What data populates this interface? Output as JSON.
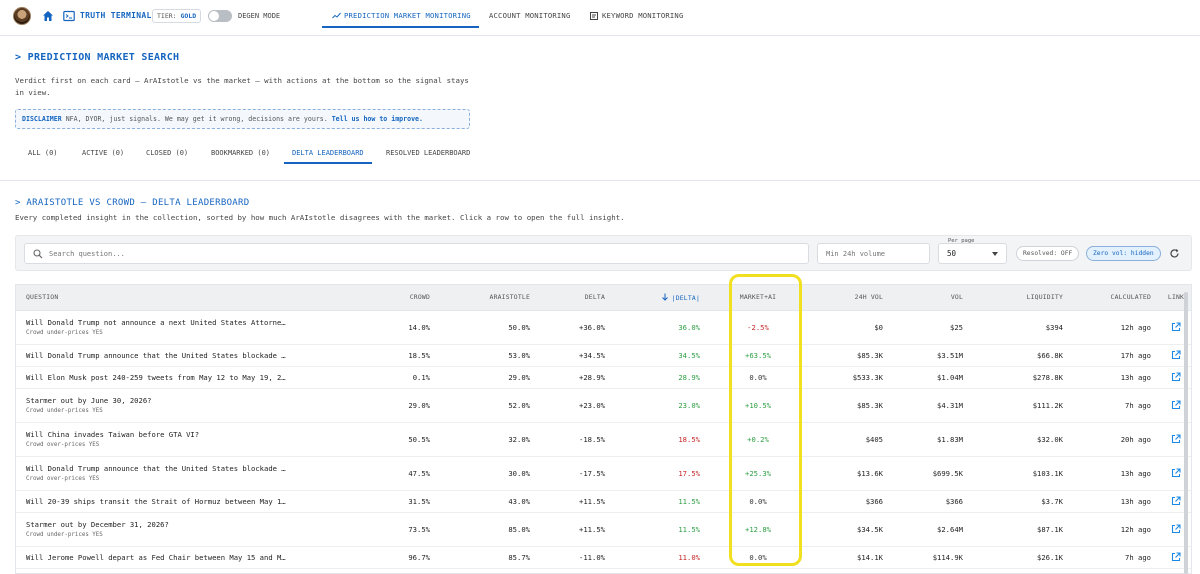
{
  "header": {
    "brand": "TRUTH TERMINAL",
    "tier_label": "TIER:",
    "tier_value": "GOLD",
    "degen_label": "DEGEN MODE",
    "nav": [
      "PREDICTION MARKET MONITORING",
      "ACCOUNT MONITORING",
      "KEYWORD MONITORING"
    ],
    "active_nav": "PREDICTION MARKET MONITORING"
  },
  "search_section": {
    "title": "> PREDICTION MARKET SEARCH",
    "description": "Verdict first on each card — ArAIstotle vs the market — with actions at the bottom so the signal stays in view.",
    "disclaimer_label": "DISCLAIMER",
    "disclaimer_text": "NFA, DYOR, just signals. We may get it wrong, decisions are yours.",
    "disclaimer_link": "Tell us how to improve.",
    "tabs": [
      "ALL (0)",
      "ACTIVE (0)",
      "CLOSED (0)",
      "BOOKMARKED (0)",
      "DELTA LEADERBOARD",
      "RESOLVED LEADERBOARD"
    ],
    "active_tab": "DELTA LEADERBOARD"
  },
  "leaderboard": {
    "title": "> ARAISTOTLE VS CROWD — DELTA LEADERBOARD",
    "description": "Every completed insight in the collection, sorted by how much ArAIstotle disagrees with the market. Click a row to open the full insight.",
    "search_placeholder": "Search question...",
    "volume_placeholder": "Min 24h volume",
    "per_page_label": "Per page",
    "per_page_value": "50",
    "resolved_chip": "Resolved: OFF",
    "zero_vol_chip": "Zero vol: hidden",
    "columns": [
      "QUESTION",
      "CROWD",
      "ARAISTOTLE",
      "DELTA",
      "|DELTA|",
      "MARKET+AI",
      "24H VOL",
      "VOL",
      "LIQUIDITY",
      "CALCULATED",
      "LINK"
    ],
    "rows": [
      {
        "question": "Will Donald Trump not announce a next United States Attorne…",
        "note": "Crowd under-prices YES",
        "crowd": "14.0%",
        "araistotle": "50.0%",
        "delta": "+36.0%",
        "abs_delta": "36.0%",
        "abs_sign": "pos",
        "market_ai": "-2.5%",
        "mai_sign": "neg",
        "vol24": "$0",
        "vol": "$25",
        "liquidity": "$394",
        "calculated": "12h ago"
      },
      {
        "question": "Will Donald Trump announce that the United States blockade …",
        "note": "",
        "crowd": "18.5%",
        "araistotle": "53.0%",
        "delta": "+34.5%",
        "abs_delta": "34.5%",
        "abs_sign": "pos",
        "market_ai": "+63.5%",
        "mai_sign": "pos",
        "vol24": "$85.3K",
        "vol": "$3.51M",
        "liquidity": "$66.8K",
        "calculated": "17h ago"
      },
      {
        "question": "Will Elon Musk post 240-259 tweets from May 12 to May 19, 2…",
        "note": "",
        "crowd": "0.1%",
        "araistotle": "29.0%",
        "delta": "+28.9%",
        "abs_delta": "28.9%",
        "abs_sign": "pos",
        "market_ai": "0.0%",
        "mai_sign": "neu",
        "vol24": "$533.3K",
        "vol": "$1.04M",
        "liquidity": "$278.8K",
        "calculated": "13h ago"
      },
      {
        "question": "Starmer out by June 30, 2026?",
        "note": "Crowd under-prices YES",
        "crowd": "29.0%",
        "araistotle": "52.0%",
        "delta": "+23.0%",
        "abs_delta": "23.0%",
        "abs_sign": "pos",
        "market_ai": "+10.5%",
        "mai_sign": "pos",
        "vol24": "$85.3K",
        "vol": "$4.31M",
        "liquidity": "$111.2K",
        "calculated": "7h ago"
      },
      {
        "question": "Will China invades Taiwan before GTA VI?",
        "note": "Crowd over-prices YES",
        "crowd": "50.5%",
        "araistotle": "32.0%",
        "delta": "-18.5%",
        "abs_delta": "18.5%",
        "abs_sign": "neg",
        "market_ai": "+0.2%",
        "mai_sign": "pos",
        "vol24": "$405",
        "vol": "$1.83M",
        "liquidity": "$32.0K",
        "calculated": "20h ago"
      },
      {
        "question": "Will Donald Trump announce that the United States blockade …",
        "note": "Crowd over-prices YES",
        "crowd": "47.5%",
        "araistotle": "30.0%",
        "delta": "-17.5%",
        "abs_delta": "17.5%",
        "abs_sign": "neg",
        "market_ai": "+25.3%",
        "mai_sign": "pos",
        "vol24": "$13.6K",
        "vol": "$699.5K",
        "liquidity": "$103.1K",
        "calculated": "13h ago"
      },
      {
        "question": "Will 20-39 ships transit the Strait of Hormuz between May 1…",
        "note": "",
        "crowd": "31.5%",
        "araistotle": "43.0%",
        "delta": "+11.5%",
        "abs_delta": "11.5%",
        "abs_sign": "pos",
        "market_ai": "0.0%",
        "mai_sign": "neu",
        "vol24": "$366",
        "vol": "$366",
        "liquidity": "$3.7K",
        "calculated": "13h ago"
      },
      {
        "question": "Starmer out by December 31, 2026?",
        "note": "Crowd under-prices YES",
        "crowd": "73.5%",
        "araistotle": "85.0%",
        "delta": "+11.5%",
        "abs_delta": "11.5%",
        "abs_sign": "pos",
        "market_ai": "+12.8%",
        "mai_sign": "pos",
        "vol24": "$34.5K",
        "vol": "$2.64M",
        "liquidity": "$87.1K",
        "calculated": "12h ago"
      },
      {
        "question": "Will Jerome Powell depart as Fed Chair between May 15 and M…",
        "note": "",
        "crowd": "96.7%",
        "araistotle": "85.7%",
        "delta": "-11.0%",
        "abs_delta": "11.0%",
        "abs_sign": "neg",
        "market_ai": "0.0%",
        "mai_sign": "neu",
        "vol24": "$14.1K",
        "vol": "$114.9K",
        "liquidity": "$26.1K",
        "calculated": "7h ago"
      }
    ]
  },
  "colors": {
    "accent": "#1565c0",
    "positive": "#2e9e44",
    "negative": "#c62828",
    "highlight": "#f0e020"
  },
  "icons": [
    "home-icon",
    "terminal-icon",
    "trend-icon",
    "keyword-icon",
    "search-icon",
    "refresh-icon",
    "sort-down-icon",
    "external-link-icon"
  ]
}
